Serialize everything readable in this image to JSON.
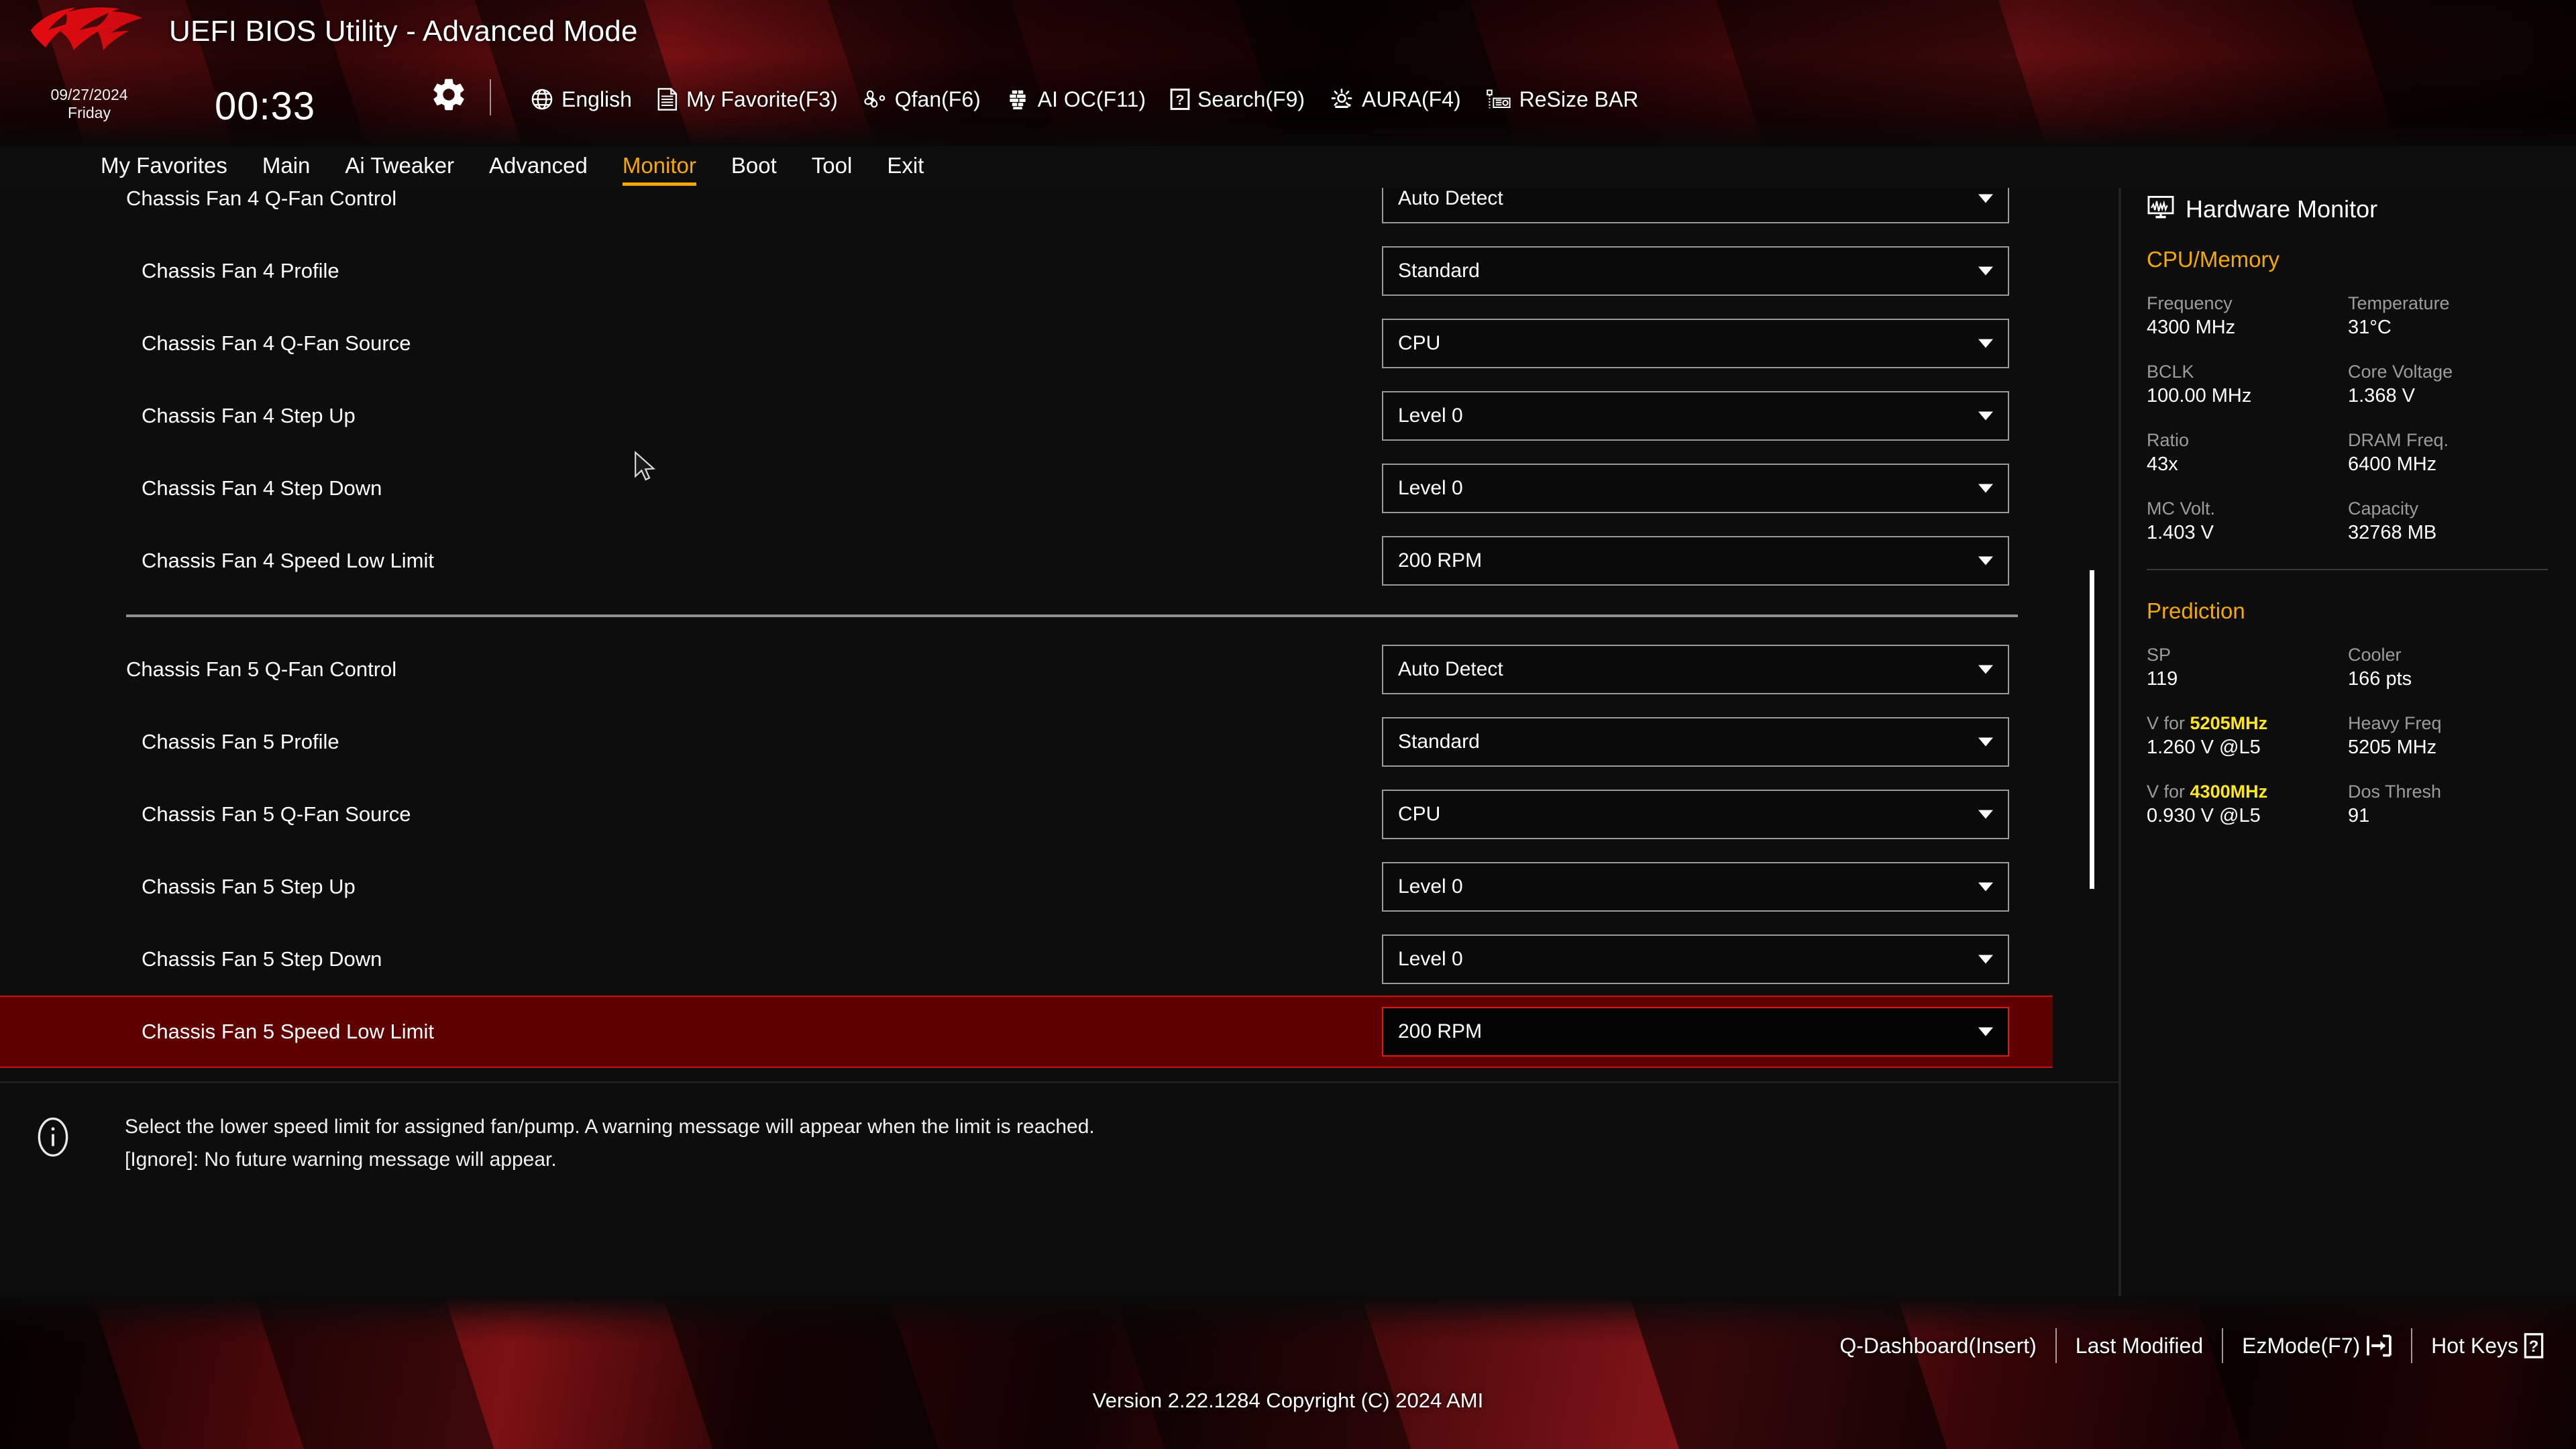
{
  "header": {
    "title": "UEFI BIOS Utility - Advanced Mode",
    "date": "09/27/2024",
    "weekday": "Friday",
    "time": "00:33",
    "gear_icon": "gear-icon",
    "toolbar": [
      {
        "icon": "globe-icon",
        "label": "English"
      },
      {
        "icon": "document-icon",
        "label": "My Favorite(F3)"
      },
      {
        "icon": "fan-icon",
        "label": "Qfan(F6)"
      },
      {
        "icon": "chip-icon",
        "label": "AI OC(F11)"
      },
      {
        "icon": "question-box-icon",
        "label": "Search(F9)"
      },
      {
        "icon": "aura-light-icon",
        "label": "AURA(F4)"
      },
      {
        "icon": "resize-bar-icon",
        "label": "ReSize BAR"
      }
    ]
  },
  "nav": {
    "tabs": [
      {
        "label": "My Favorites",
        "active": false
      },
      {
        "label": "Main",
        "active": false
      },
      {
        "label": "Ai Tweaker",
        "active": false
      },
      {
        "label": "Advanced",
        "active": false
      },
      {
        "label": "Monitor",
        "active": true
      },
      {
        "label": "Boot",
        "active": false
      },
      {
        "label": "Tool",
        "active": false
      },
      {
        "label": "Exit",
        "active": false
      }
    ],
    "active_color": "#f5a800"
  },
  "settings": {
    "rows": [
      {
        "label": "Chassis Fan 4 Q-Fan Control",
        "value": "Auto Detect",
        "indent": 1,
        "selected": false,
        "clipped": true
      },
      {
        "label": "Chassis Fan 4 Profile",
        "value": "Standard",
        "indent": 2,
        "selected": false
      },
      {
        "label": "Chassis Fan 4 Q-Fan Source",
        "value": "CPU",
        "indent": 2,
        "selected": false
      },
      {
        "label": "Chassis Fan 4 Step Up",
        "value": "Level 0",
        "indent": 2,
        "selected": false
      },
      {
        "label": "Chassis Fan 4 Step Down",
        "value": "Level 0",
        "indent": 2,
        "selected": false
      },
      {
        "label": "Chassis Fan 4 Speed Low Limit",
        "value": "200 RPM",
        "indent": 2,
        "selected": false
      },
      {
        "separator": true
      },
      {
        "label": "Chassis Fan 5 Q-Fan Control",
        "value": "Auto Detect",
        "indent": 1,
        "selected": false
      },
      {
        "label": "Chassis Fan 5 Profile",
        "value": "Standard",
        "indent": 2,
        "selected": false
      },
      {
        "label": "Chassis Fan 5 Q-Fan Source",
        "value": "CPU",
        "indent": 2,
        "selected": false
      },
      {
        "label": "Chassis Fan 5 Step Up",
        "value": "Level 0",
        "indent": 2,
        "selected": false
      },
      {
        "label": "Chassis Fan 5 Step Down",
        "value": "Level 0",
        "indent": 2,
        "selected": false
      },
      {
        "label": "Chassis Fan 5 Speed Low Limit",
        "value": "200 RPM",
        "indent": 2,
        "selected": true
      }
    ],
    "selected_bg": "#5e0000",
    "selected_border": "#c81010"
  },
  "help": {
    "icon": "info-icon",
    "line1": "Select the lower speed limit for assigned fan/pump. A warning message will appear when the limit is reached.",
    "line2": "[Ignore]: No future warning message will appear."
  },
  "hardware_monitor": {
    "icon": "monitor-waveform-icon",
    "title": "Hardware Monitor",
    "sections": [
      {
        "name": "CPU/Memory",
        "pairs": [
          [
            {
              "key": "Frequency",
              "value": "4300 MHz"
            },
            {
              "key": "Temperature",
              "value": "31°C"
            }
          ],
          [
            {
              "key": "BCLK",
              "value": "100.00 MHz"
            },
            {
              "key": "Core Voltage",
              "value": "1.368 V"
            }
          ],
          [
            {
              "key": "Ratio",
              "value": "43x"
            },
            {
              "key": "DRAM Freq.",
              "value": "6400 MHz"
            }
          ],
          [
            {
              "key": "MC Volt.",
              "value": "1.403 V"
            },
            {
              "key": "Capacity",
              "value": "32768 MB"
            }
          ]
        ]
      },
      {
        "name": "Prediction",
        "pairs": [
          [
            {
              "key": "SP",
              "value": "119"
            },
            {
              "key": "Cooler",
              "value": "166 pts"
            }
          ],
          [
            {
              "key": "V for ",
              "key_hi": "5205MHz",
              "value": "1.260 V @L5"
            },
            {
              "key": "Heavy Freq",
              "value": "5205 MHz"
            }
          ],
          [
            {
              "key": "V for ",
              "key_hi": "4300MHz",
              "value": "0.930 V @L5"
            },
            {
              "key": "Dos Thresh",
              "value": "91"
            }
          ]
        ]
      }
    ],
    "section_color": "#f5a800",
    "highlight_color": "#ffe81a"
  },
  "footer": {
    "links": [
      {
        "label": "Q-Dashboard(Insert)",
        "icon": null
      },
      {
        "label": "Last Modified",
        "icon": null
      },
      {
        "label": "EzMode(F7)",
        "icon": "exit-arrow-icon"
      },
      {
        "label": "Hot Keys",
        "icon": "question-box-icon"
      }
    ],
    "version": "Version 2.22.1284 Copyright (C) 2024 AMI"
  }
}
